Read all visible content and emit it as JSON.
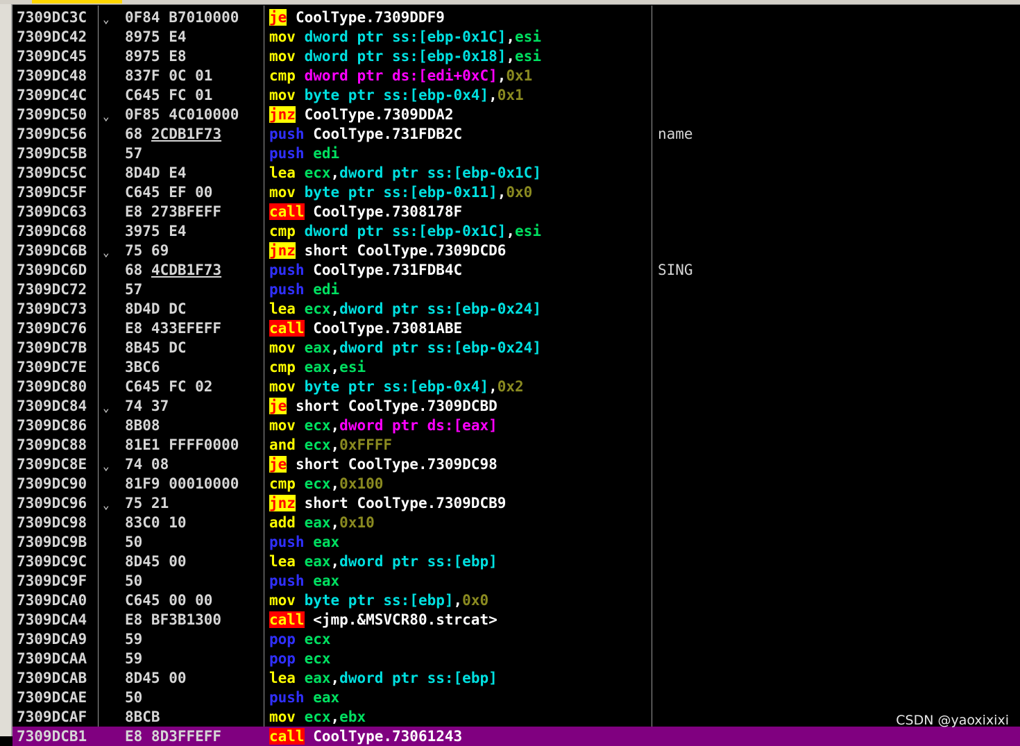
{
  "watermark": "CSDN @yaoxixixi",
  "colors": {
    "background": "#000000",
    "selected_row": "#800080",
    "jump_highlight": "#ffff00",
    "call_highlight": "#ff0000"
  },
  "rows": [
    {
      "addr": "7309DC3C",
      "arrow": true,
      "bytes": "0F84 B7010000",
      "dis": [
        {
          "t": "je",
          "c": "t-jmp"
        },
        {
          "t": " CoolType.7309DDF9",
          "c": "t-sym"
        }
      ]
    },
    {
      "addr": "7309DC42",
      "bytes": "8975 E4",
      "dis": [
        {
          "t": "mov",
          "c": "t-mnem"
        },
        {
          "t": " dword ptr ss:[ebp-0x1C]",
          "c": "t-seg"
        },
        {
          "t": ",",
          "c": "t-p"
        },
        {
          "t": "esi",
          "c": "t-reg"
        }
      ]
    },
    {
      "addr": "7309DC45",
      "bytes": "8975 E8",
      "dis": [
        {
          "t": "mov",
          "c": "t-mnem"
        },
        {
          "t": " dword ptr ss:[ebp-0x18]",
          "c": "t-seg"
        },
        {
          "t": ",",
          "c": "t-p"
        },
        {
          "t": "esi",
          "c": "t-reg"
        }
      ]
    },
    {
      "addr": "7309DC48",
      "bytes": "837F 0C 01",
      "dis": [
        {
          "t": "cmp",
          "c": "t-mnem"
        },
        {
          "t": " dword ptr ds:[edi+0xC]",
          "c": "t-dsmem"
        },
        {
          "t": ",",
          "c": "t-p"
        },
        {
          "t": "0x1",
          "c": "t-imm"
        }
      ]
    },
    {
      "addr": "7309DC4C",
      "bytes": "C645 FC 01",
      "dis": [
        {
          "t": "mov",
          "c": "t-mnem"
        },
        {
          "t": " byte ptr ss:[ebp-0x4]",
          "c": "t-seg"
        },
        {
          "t": ",",
          "c": "t-p"
        },
        {
          "t": "0x1",
          "c": "t-imm"
        }
      ]
    },
    {
      "addr": "7309DC50",
      "arrow": true,
      "bytes": "0F85 4C010000",
      "dis": [
        {
          "t": "jnz",
          "c": "t-jmp"
        },
        {
          "t": " CoolType.7309DDA2",
          "c": "t-sym"
        }
      ]
    },
    {
      "addr": "7309DC56",
      "bytes_pre": "68 ",
      "bytes_ul": "2CDB1F73",
      "dis": [
        {
          "t": "push",
          "c": "t-push"
        },
        {
          "t": " CoolType.731FDB2C",
          "c": "t-sym"
        }
      ],
      "comment": "name"
    },
    {
      "addr": "7309DC5B",
      "bytes": "57",
      "dis": [
        {
          "t": "push",
          "c": "t-push"
        },
        {
          "t": " edi",
          "c": "t-reg"
        }
      ]
    },
    {
      "addr": "7309DC5C",
      "bytes": "8D4D E4",
      "dis": [
        {
          "t": "lea",
          "c": "t-mnem"
        },
        {
          "t": " ecx",
          "c": "t-reg"
        },
        {
          "t": ",",
          "c": "t-p"
        },
        {
          "t": "dword ptr ss:[ebp-0x1C]",
          "c": "t-seg"
        }
      ]
    },
    {
      "addr": "7309DC5F",
      "bytes": "C645 EF 00",
      "dis": [
        {
          "t": "mov",
          "c": "t-mnem"
        },
        {
          "t": " byte ptr ss:[ebp-0x11]",
          "c": "t-seg"
        },
        {
          "t": ",",
          "c": "t-p"
        },
        {
          "t": "0x0",
          "c": "t-imm"
        }
      ]
    },
    {
      "addr": "7309DC63",
      "bytes": "E8 273BFEFF",
      "dis": [
        {
          "t": "call",
          "c": "t-call"
        },
        {
          "t": " CoolType.7308178F",
          "c": "t-sym"
        }
      ]
    },
    {
      "addr": "7309DC68",
      "bytes": "3975 E4",
      "dis": [
        {
          "t": "cmp",
          "c": "t-mnem"
        },
        {
          "t": " dword ptr ss:[ebp-0x1C]",
          "c": "t-seg"
        },
        {
          "t": ",",
          "c": "t-p"
        },
        {
          "t": "esi",
          "c": "t-reg"
        }
      ]
    },
    {
      "addr": "7309DC6B",
      "arrow": true,
      "bytes": "75 69",
      "dis": [
        {
          "t": "jnz",
          "c": "t-jmp"
        },
        {
          "t": " short CoolType.7309DCD6",
          "c": "t-sym"
        }
      ]
    },
    {
      "addr": "7309DC6D",
      "bytes_pre": "68 ",
      "bytes_ul": "4CDB1F73",
      "dis": [
        {
          "t": "push",
          "c": "t-push"
        },
        {
          "t": " CoolType.731FDB4C",
          "c": "t-sym"
        }
      ],
      "comment": "SING"
    },
    {
      "addr": "7309DC72",
      "bytes": "57",
      "dis": [
        {
          "t": "push",
          "c": "t-push"
        },
        {
          "t": " edi",
          "c": "t-reg"
        }
      ]
    },
    {
      "addr": "7309DC73",
      "bytes": "8D4D DC",
      "dis": [
        {
          "t": "lea",
          "c": "t-mnem"
        },
        {
          "t": " ecx",
          "c": "t-reg"
        },
        {
          "t": ",",
          "c": "t-p"
        },
        {
          "t": "dword ptr ss:[ebp-0x24]",
          "c": "t-seg"
        }
      ]
    },
    {
      "addr": "7309DC76",
      "bytes": "E8 433EFEFF",
      "dis": [
        {
          "t": "call",
          "c": "t-call"
        },
        {
          "t": " CoolType.73081ABE",
          "c": "t-sym"
        }
      ]
    },
    {
      "addr": "7309DC7B",
      "bytes": "8B45 DC",
      "dis": [
        {
          "t": "mov",
          "c": "t-mnem"
        },
        {
          "t": " eax",
          "c": "t-reg"
        },
        {
          "t": ",",
          "c": "t-p"
        },
        {
          "t": "dword ptr ss:[ebp-0x24]",
          "c": "t-seg"
        }
      ]
    },
    {
      "addr": "7309DC7E",
      "bytes": "3BC6",
      "dis": [
        {
          "t": "cmp",
          "c": "t-mnem"
        },
        {
          "t": " eax",
          "c": "t-reg"
        },
        {
          "t": ",",
          "c": "t-p"
        },
        {
          "t": "esi",
          "c": "t-reg"
        }
      ]
    },
    {
      "addr": "7309DC80",
      "bytes": "C645 FC 02",
      "dis": [
        {
          "t": "mov",
          "c": "t-mnem"
        },
        {
          "t": " byte ptr ss:[ebp-0x4]",
          "c": "t-seg"
        },
        {
          "t": ",",
          "c": "t-p"
        },
        {
          "t": "0x2",
          "c": "t-imm"
        }
      ]
    },
    {
      "addr": "7309DC84",
      "arrow": true,
      "bytes": "74 37",
      "dis": [
        {
          "t": "je",
          "c": "t-jmp"
        },
        {
          "t": " short CoolType.7309DCBD",
          "c": "t-sym"
        }
      ]
    },
    {
      "addr": "7309DC86",
      "bytes": "8B08",
      "dis": [
        {
          "t": "mov",
          "c": "t-mnem"
        },
        {
          "t": " ecx",
          "c": "t-reg"
        },
        {
          "t": ",",
          "c": "t-p"
        },
        {
          "t": "dword ptr ds:[eax]",
          "c": "t-dsmem"
        }
      ]
    },
    {
      "addr": "7309DC88",
      "bytes": "81E1 FFFF0000",
      "dis": [
        {
          "t": "and",
          "c": "t-mnem"
        },
        {
          "t": " ecx",
          "c": "t-reg"
        },
        {
          "t": ",",
          "c": "t-p"
        },
        {
          "t": "0xFFFF",
          "c": "t-imm"
        }
      ]
    },
    {
      "addr": "7309DC8E",
      "arrow": true,
      "bytes": "74 08",
      "dis": [
        {
          "t": "je",
          "c": "t-jmp"
        },
        {
          "t": " short CoolType.7309DC98",
          "c": "t-sym"
        }
      ]
    },
    {
      "addr": "7309DC90",
      "bytes": "81F9 00010000",
      "dis": [
        {
          "t": "cmp",
          "c": "t-mnem"
        },
        {
          "t": " ecx",
          "c": "t-reg"
        },
        {
          "t": ",",
          "c": "t-p"
        },
        {
          "t": "0x100",
          "c": "t-imm"
        }
      ]
    },
    {
      "addr": "7309DC96",
      "arrow": true,
      "bytes": "75 21",
      "dis": [
        {
          "t": "jnz",
          "c": "t-jmp"
        },
        {
          "t": " short CoolType.7309DCB9",
          "c": "t-sym"
        }
      ]
    },
    {
      "addr": "7309DC98",
      "bytes": "83C0 10",
      "dis": [
        {
          "t": "add",
          "c": "t-mnem"
        },
        {
          "t": " eax",
          "c": "t-reg"
        },
        {
          "t": ",",
          "c": "t-p"
        },
        {
          "t": "0x10",
          "c": "t-imm"
        }
      ]
    },
    {
      "addr": "7309DC9B",
      "bytes": "50",
      "dis": [
        {
          "t": "push",
          "c": "t-push"
        },
        {
          "t": " eax",
          "c": "t-reg"
        }
      ]
    },
    {
      "addr": "7309DC9C",
      "bytes": "8D45 00",
      "dis": [
        {
          "t": "lea",
          "c": "t-mnem"
        },
        {
          "t": " eax",
          "c": "t-reg"
        },
        {
          "t": ",",
          "c": "t-p"
        },
        {
          "t": "dword ptr ss:[ebp]",
          "c": "t-seg"
        }
      ]
    },
    {
      "addr": "7309DC9F",
      "bytes": "50",
      "dis": [
        {
          "t": "push",
          "c": "t-push"
        },
        {
          "t": " eax",
          "c": "t-reg"
        }
      ]
    },
    {
      "addr": "7309DCA0",
      "bytes": "C645 00 00",
      "dis": [
        {
          "t": "mov",
          "c": "t-mnem"
        },
        {
          "t": " byte ptr ss:[ebp]",
          "c": "t-seg"
        },
        {
          "t": ",",
          "c": "t-p"
        },
        {
          "t": "0x0",
          "c": "t-imm"
        }
      ]
    },
    {
      "addr": "7309DCA4",
      "bytes": "E8 BF3B1300",
      "dis": [
        {
          "t": "call",
          "c": "t-call"
        },
        {
          "t": " <jmp.&MSVCR80.strcat>",
          "c": "t-sym"
        }
      ]
    },
    {
      "addr": "7309DCA9",
      "bytes": "59",
      "dis": [
        {
          "t": "pop",
          "c": "t-push"
        },
        {
          "t": " ecx",
          "c": "t-reg"
        }
      ]
    },
    {
      "addr": "7309DCAA",
      "bytes": "59",
      "dis": [
        {
          "t": "pop",
          "c": "t-push"
        },
        {
          "t": " ecx",
          "c": "t-reg"
        }
      ]
    },
    {
      "addr": "7309DCAB",
      "bytes": "8D45 00",
      "dis": [
        {
          "t": "lea",
          "c": "t-mnem"
        },
        {
          "t": " eax",
          "c": "t-reg"
        },
        {
          "t": ",",
          "c": "t-p"
        },
        {
          "t": "dword ptr ss:[ebp]",
          "c": "t-seg"
        }
      ]
    },
    {
      "addr": "7309DCAE",
      "bytes": "50",
      "dis": [
        {
          "t": "push",
          "c": "t-push"
        },
        {
          "t": " eax",
          "c": "t-reg"
        }
      ]
    },
    {
      "addr": "7309DCAF",
      "bytes": "8BCB",
      "dis": [
        {
          "t": "mov",
          "c": "t-mnem"
        },
        {
          "t": " ecx",
          "c": "t-reg"
        },
        {
          "t": ",",
          "c": "t-p"
        },
        {
          "t": "ebx",
          "c": "t-reg"
        }
      ]
    },
    {
      "addr": "7309DCB1",
      "bytes": "E8 8D3FFEFF",
      "selected": true,
      "dis": [
        {
          "t": "call",
          "c": "t-call"
        },
        {
          "t": " CoolType.73061243",
          "c": "t-sym"
        }
      ]
    }
  ]
}
